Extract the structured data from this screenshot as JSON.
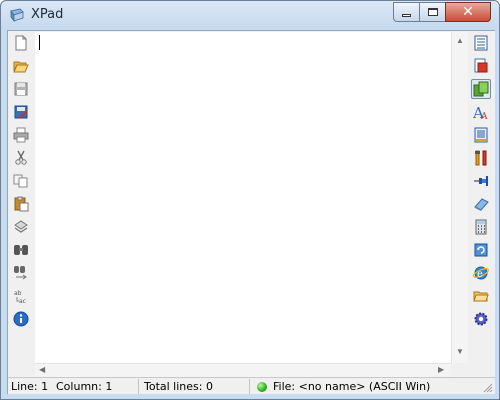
{
  "window": {
    "title": "XPad",
    "close_glyph": "✕"
  },
  "left_toolbar": [
    {
      "icon": "new-document-icon"
    },
    {
      "icon": "open-folder-icon"
    },
    {
      "icon": "save-icon"
    },
    {
      "icon": "save-as-icon"
    },
    {
      "icon": "print-icon"
    },
    {
      "icon": "cut-icon"
    },
    {
      "icon": "copy-icon"
    },
    {
      "icon": "paste-icon"
    },
    {
      "icon": "undo-icon"
    },
    {
      "icon": "find-icon"
    },
    {
      "icon": "find-next-icon"
    },
    {
      "icon": "replace-icon"
    },
    {
      "icon": "info-icon"
    }
  ],
  "right_toolbar": [
    {
      "icon": "document-list-icon",
      "active": false
    },
    {
      "icon": "document-red-icon",
      "active": false
    },
    {
      "icon": "copy-green-icon",
      "active": true
    },
    {
      "icon": "font-icon",
      "active": false
    },
    {
      "icon": "text-document-icon",
      "active": false
    },
    {
      "icon": "tools-icon",
      "active": false
    },
    {
      "icon": "pin-icon",
      "active": false
    },
    {
      "icon": "eraser-icon",
      "active": false
    },
    {
      "icon": "calculator-icon",
      "active": false
    },
    {
      "icon": "refresh-window-icon",
      "active": false
    },
    {
      "icon": "internet-explorer-icon",
      "active": false
    },
    {
      "icon": "folder-open-icon",
      "active": false
    },
    {
      "icon": "settings-gear-icon",
      "active": false
    }
  ],
  "status": {
    "line": "Line: 1",
    "column": "Column: 1",
    "total": "Total lines: 0",
    "file": "File: <no name> (ASCII Win)",
    "led_color": "#2bb01c"
  }
}
